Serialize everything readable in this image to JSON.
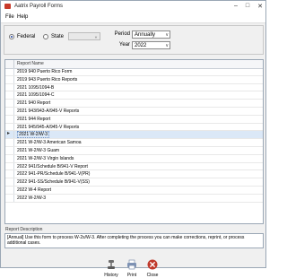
{
  "window": {
    "title": "Aatrix Payroll Forms"
  },
  "menu": {
    "items": [
      "File",
      "Help"
    ]
  },
  "params": {
    "federal_label": "Federal",
    "state_label": "State",
    "state_value": "",
    "period_label": "Period",
    "period_value": "Annually",
    "year_label": "Year",
    "year_value": "2022"
  },
  "grid": {
    "column": "Report Name",
    "selected_index": 11,
    "rows": [
      "2019 940 Puerto Rico Form",
      "2019 943 Puerto Rico Reports",
      "2021 1095/1094-B",
      "2021 1095/1094-C",
      "2021 940 Report",
      "2021 943/943-A/945-V Reports",
      "2021 944 Report",
      "2021 945/945-A/945-V Reports",
      "2021 W-2/W-3",
      "2021 W-2/W-3 American Samoa",
      "2021 W-2/W-3 Guam",
      "2021 W-2/W-3 Virgin Islands",
      "2022 941/Schedule B/941-V Report",
      "2022 941-PR/Schedule B/941-V(PR)",
      "2022 941-SS/Schedule B/941-V(SS)",
      "2022 W-4 Report",
      "2022 W-2/W-3"
    ],
    "display_rows": [
      "2019 940 Puerto Rico Form",
      "2019 943 Puerto Rico Reports",
      "2021 1095/1094-B",
      "2021 1095/1094-C",
      "2021 940 Report",
      "2021 943/943-A/945-V Reports",
      "2021 944 Report",
      "2021 945/945-A/945-V Reports",
      "2021 W-2/W-3",
      "2021 W-2/W-3 American Samoa",
      "2021 W-2/W-3 Guam",
      "2021 W-2/W-3 Virgin Islands",
      "2022 941/Schedule B/941-V Report",
      "2022 941-PR/Schedule B/941-V(PR)",
      "2022 941-SS/Schedule B/941-V(SS)",
      "2022 W-4 Report",
      "2022 W-2/W-3"
    ]
  },
  "description": {
    "label": "Report Description",
    "text": "[Annual] Use this form to process W-2s/W-3. After completing the process you can make corrections, reprint, or process additional cases."
  },
  "toolbar": {
    "history_label": "History",
    "print_label": "Print",
    "close_label": "Close"
  },
  "colors": {
    "selected_row": "#dbe8f7",
    "close_red": "#c0392b"
  }
}
